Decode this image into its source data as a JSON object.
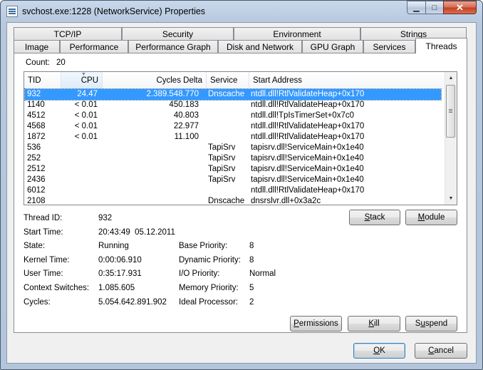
{
  "window": {
    "title": "svchost.exe:1228 (NetworkService) Properties",
    "minimize_glyph": "▁",
    "maximize_glyph": "□",
    "close_glyph": "✕"
  },
  "tabs_top": [
    "TCP/IP",
    "Security",
    "Environment",
    "Strings"
  ],
  "tabs_bottom": [
    "Image",
    "Performance",
    "Performance Graph",
    "Disk and Network",
    "GPU Graph",
    "Services",
    "Threads"
  ],
  "active_tab": "Threads",
  "count": {
    "label": "Count:",
    "value": "20"
  },
  "list": {
    "columns": [
      "TID",
      "CPU",
      "Cycles Delta",
      "Service",
      "Start Address"
    ],
    "sorted_column": "CPU",
    "rows": [
      {
        "tid": "932",
        "cpu": "24.47",
        "cycles": "2.389.548.770",
        "service": "Dnscache",
        "address": "ntdll.dll!RtlValidateHeap+0x170"
      },
      {
        "tid": "1140",
        "cpu": "< 0.01",
        "cycles": "450.183",
        "service": "",
        "address": "ntdll.dll!RtlValidateHeap+0x170"
      },
      {
        "tid": "4512",
        "cpu": "< 0.01",
        "cycles": "40.803",
        "service": "",
        "address": "ntdll.dll!TpIsTimerSet+0x7c0"
      },
      {
        "tid": "4568",
        "cpu": "< 0.01",
        "cycles": "22.977",
        "service": "",
        "address": "ntdll.dll!RtlValidateHeap+0x170"
      },
      {
        "tid": "1872",
        "cpu": "< 0.01",
        "cycles": "11.100",
        "service": "",
        "address": "ntdll.dll!RtlValidateHeap+0x170"
      },
      {
        "tid": "536",
        "cpu": "",
        "cycles": "",
        "service": "TapiSrv",
        "address": "tapisrv.dll!ServiceMain+0x1e40"
      },
      {
        "tid": "252",
        "cpu": "",
        "cycles": "",
        "service": "TapiSrv",
        "address": "tapisrv.dll!ServiceMain+0x1e40"
      },
      {
        "tid": "2512",
        "cpu": "",
        "cycles": "",
        "service": "TapiSrv",
        "address": "tapisrv.dll!ServiceMain+0x1e40"
      },
      {
        "tid": "2436",
        "cpu": "",
        "cycles": "",
        "service": "TapiSrv",
        "address": "tapisrv.dll!ServiceMain+0x1e40"
      },
      {
        "tid": "6012",
        "cpu": "",
        "cycles": "",
        "service": "",
        "address": "ntdll.dll!RtlValidateHeap+0x170"
      },
      {
        "tid": "2108",
        "cpu": "",
        "cycles": "",
        "service": "Dnscache",
        "address": "dnsrslvr.dll+0x3a2c"
      }
    ],
    "selected_row": 0,
    "scroll_up_glyph": "▲",
    "scroll_down_glyph": "▼"
  },
  "details": {
    "thread_id_label": "Thread ID:",
    "thread_id": "932",
    "start_time_label": "Start Time:",
    "start_time": "20:43:49  05.12.2011",
    "state_label": "State:",
    "state": "Running",
    "kernel_time_label": "Kernel Time:",
    "kernel_time": "0:00:06.910",
    "user_time_label": "User Time:",
    "user_time": "0:35:17.931",
    "context_switches_label": "Context Switches:",
    "context_switches": "1.085.605",
    "cycles_label": "Cycles:",
    "cycles": "5.054.642.891.902",
    "base_priority_label": "Base Priority:",
    "base_priority": "8",
    "dynamic_priority_label": "Dynamic Priority:",
    "dynamic_priority": "8",
    "io_priority_label": "I/O Priority:",
    "io_priority": "Normal",
    "memory_priority_label": "Memory Priority:",
    "memory_priority": "5",
    "ideal_processor_label": "Ideal Processor:",
    "ideal_processor": "2"
  },
  "buttons": {
    "stack": {
      "pre": "",
      "u": "S",
      "post": "tack"
    },
    "module": {
      "pre": "",
      "u": "M",
      "post": "odule"
    },
    "permissions": {
      "pre": "",
      "u": "P",
      "post": "ermissions"
    },
    "kill": {
      "pre": "",
      "u": "K",
      "post": "ill"
    },
    "suspend": {
      "pre": "S",
      "u": "u",
      "post": "spend"
    },
    "ok": {
      "pre": "",
      "u": "O",
      "post": "K"
    },
    "cancel": {
      "pre": "",
      "u": "C",
      "post": "ancel"
    }
  }
}
